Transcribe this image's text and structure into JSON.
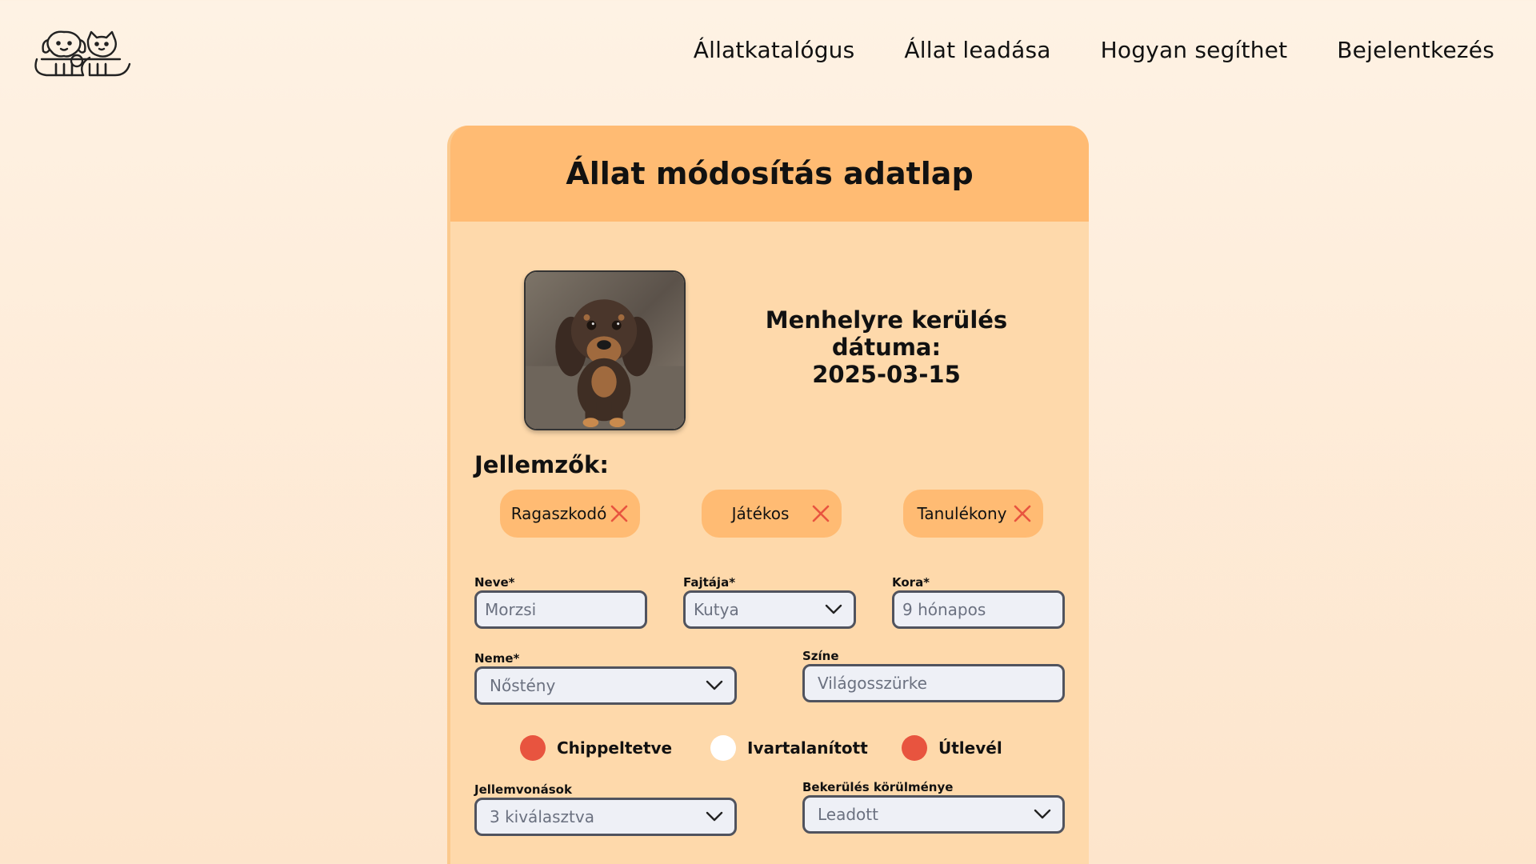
{
  "nav": {
    "items": [
      {
        "label": "Állatkatalógus"
      },
      {
        "label": "Állat leadása"
      },
      {
        "label": "Hogyan segíthet"
      },
      {
        "label": "Bejelentkezés"
      }
    ]
  },
  "card": {
    "title": "Állat módosítás adatlap",
    "intake_label": "Menhelyre kerülés dátuma:",
    "intake_date": "2025-03-15",
    "traits_heading": "Jellemzők:",
    "traits": [
      {
        "label": "Ragaszkodó"
      },
      {
        "label": "Játékos"
      },
      {
        "label": "Tanulékony"
      }
    ]
  },
  "form": {
    "name": {
      "label": "Neve*",
      "value": "Morzsi"
    },
    "species": {
      "label": "Fajtája*",
      "value": "Kutya"
    },
    "age": {
      "label": "Kora*",
      "value": "9 hónapos"
    },
    "sex": {
      "label": "Neme*",
      "value": "Nőstény"
    },
    "color": {
      "label": "Színe",
      "value": "Világosszürke"
    },
    "flags": [
      {
        "label": "Chippeltetve",
        "checked": true
      },
      {
        "label": "Ivartalanított",
        "checked": false
      },
      {
        "label": "Útlevél",
        "checked": true
      }
    ],
    "traits_select": {
      "label": "Jellemvonások",
      "value": "3 kiválasztva"
    },
    "intake_circumstance": {
      "label": "Bekerülés körülménye",
      "value": "Leadott"
    }
  },
  "icons": {
    "logo": "dog-cat-logo-icon",
    "remove": "close-icon",
    "dropdown": "chevron-down-icon"
  },
  "colors": {
    "accent": "#ffbb73",
    "card": "#fed9ab",
    "check_on": "#e8543f",
    "remove_x": "#e8543f"
  }
}
